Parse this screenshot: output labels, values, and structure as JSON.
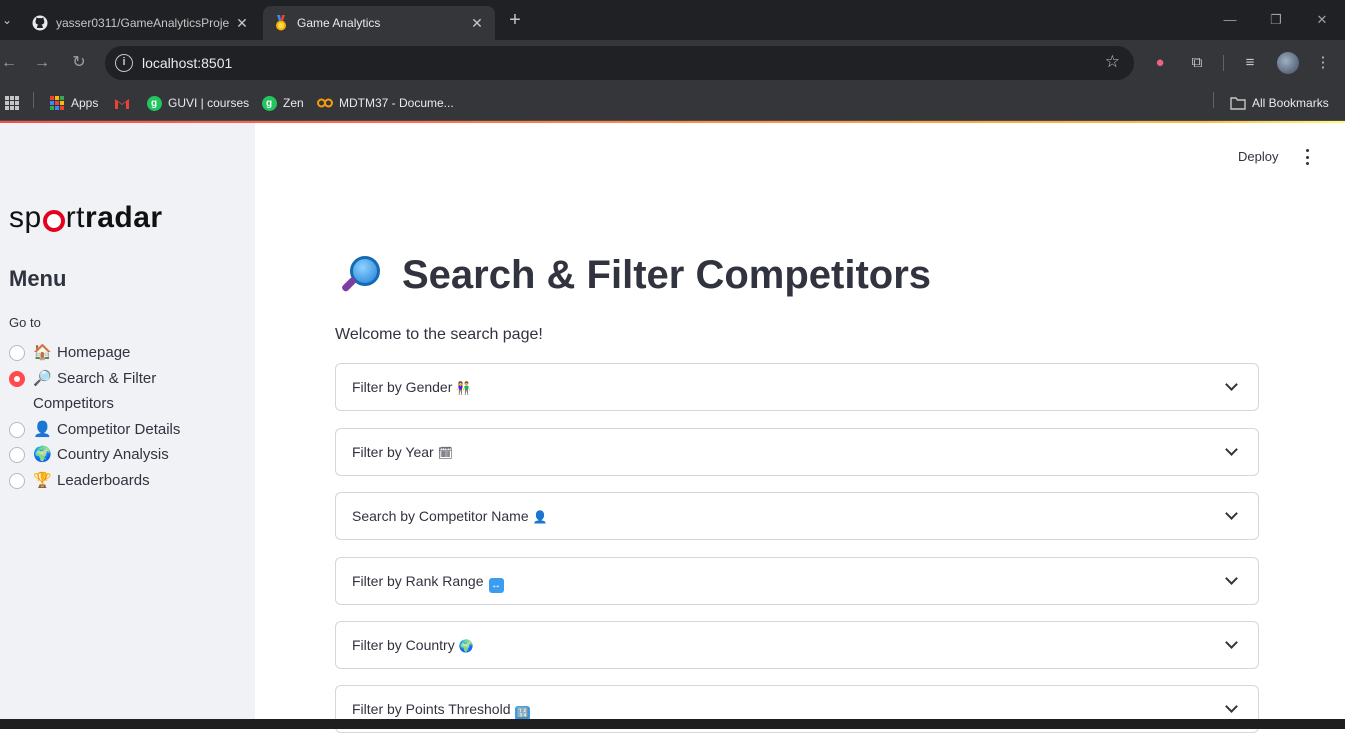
{
  "browser": {
    "tabs": [
      {
        "title": "yasser0311/GameAnalyticsProje",
        "icon": "github-icon",
        "active": false
      },
      {
        "title": "Game Analytics",
        "icon": "medal-icon",
        "active": true
      }
    ],
    "url": "localhost:8501",
    "bookmarks": [
      {
        "label": "Apps",
        "icon": "apps-grid-icon"
      },
      {
        "label": "",
        "icon": "gmail-icon"
      },
      {
        "label": "GUVI | courses",
        "icon": "guvi-icon"
      },
      {
        "label": "Zen",
        "icon": "zen-icon"
      },
      {
        "label": "MDTM37 - Docume...",
        "icon": "mdtm-icon"
      }
    ],
    "all_bookmarks": "All Bookmarks"
  },
  "sidebar": {
    "logo": {
      "part1": "sp",
      "part2": "rt",
      "part3": "radar"
    },
    "menu_title": "Menu",
    "goto_label": "Go to",
    "items": [
      {
        "emoji": "🏠",
        "label": "Homepage",
        "checked": false
      },
      {
        "emoji": "🔎",
        "label": "Search & Filter Competitors",
        "checked": true
      },
      {
        "emoji": "👤",
        "label": "Competitor Details",
        "checked": false
      },
      {
        "emoji": "🌍",
        "label": "Country Analysis",
        "checked": false
      },
      {
        "emoji": "🏆",
        "label": "Leaderboards",
        "checked": false
      }
    ]
  },
  "header": {
    "deploy_label": "Deploy"
  },
  "main": {
    "title": "Search & Filter Competitors",
    "welcome": "Welcome to the search page!",
    "expanders": [
      {
        "label": "Filter by Gender",
        "emoji": "👫"
      },
      {
        "label": "Filter by Year",
        "emoji": "🗓"
      },
      {
        "label": "Search by Competitor Name",
        "emoji": "👤"
      },
      {
        "label": "Filter by Rank Range",
        "emoji": "↔"
      },
      {
        "label": "Filter by Country",
        "emoji": "🌍"
      },
      {
        "label": "Filter by Points Threshold",
        "emoji": "🔢"
      }
    ]
  },
  "colors": {
    "accent": "#ff4b4b",
    "sidebar_bg": "#f0f2f6",
    "text": "#31333f"
  }
}
